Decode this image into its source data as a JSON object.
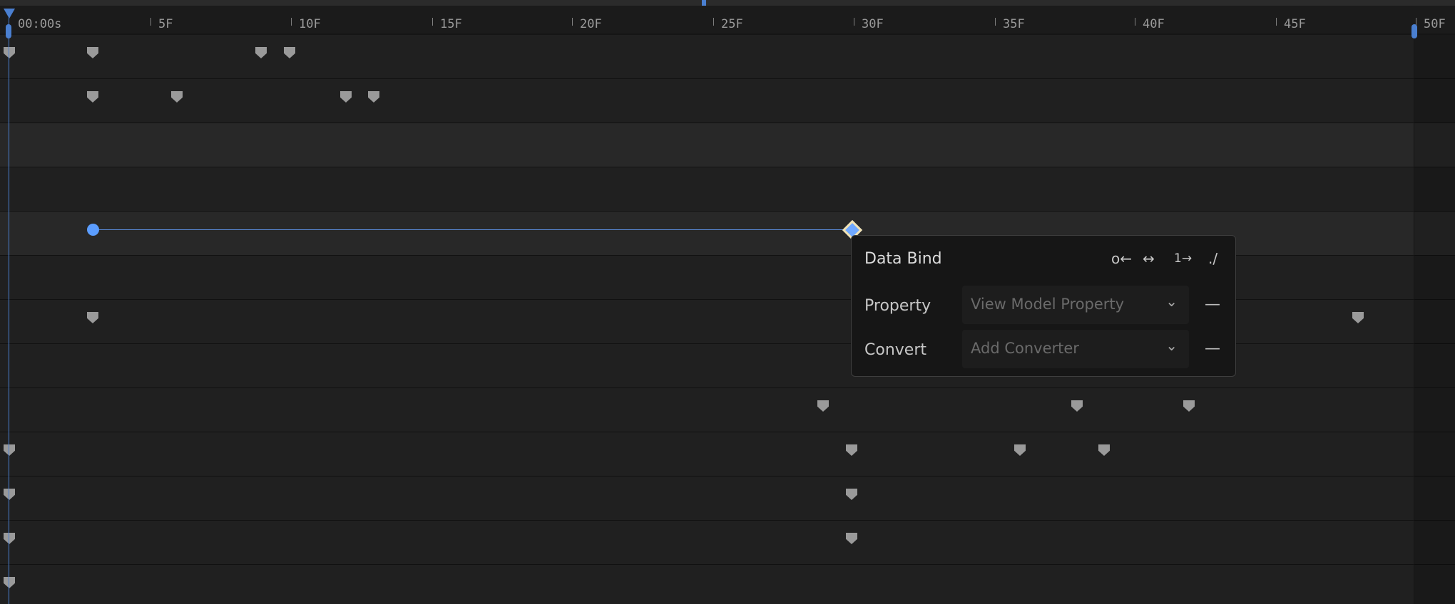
{
  "timeline": {
    "playhead_time": "00:00s",
    "frame_labels": [
      "5F",
      "10F",
      "15F",
      "20F",
      "25F",
      "30F",
      "35F",
      "40F",
      "45F",
      "50F"
    ],
    "accent_color": "#4a7fd0",
    "keyframe_color": "#9a9a9a"
  },
  "popup": {
    "title": "Data Bind",
    "icons": [
      "bind-source-to-target-icon",
      "bind-two-way-icon",
      "bind-once-icon",
      "relative-path-icon"
    ],
    "icon_glyphs": [
      "o←",
      "↔",
      "1→",
      "./"
    ],
    "property_label": "Property",
    "property_value": "View Model Property",
    "convert_label": "Convert",
    "convert_value": "Add Converter",
    "remove_glyph": "—"
  }
}
